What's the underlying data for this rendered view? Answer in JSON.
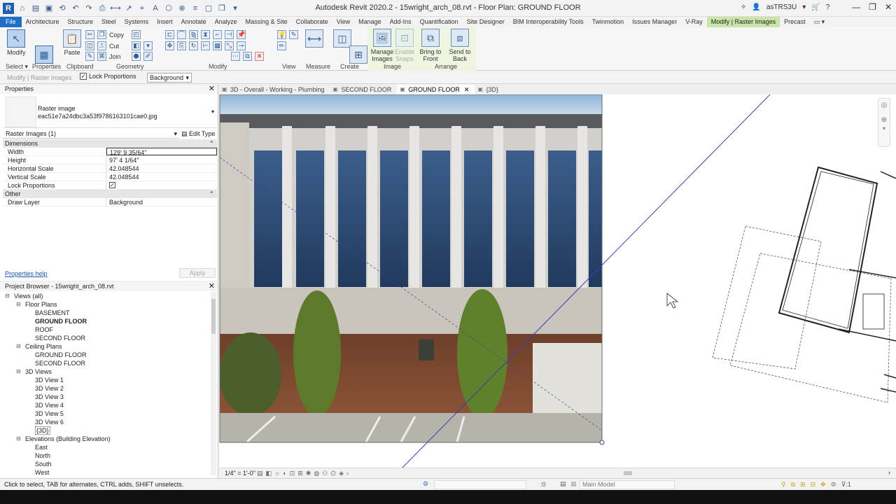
{
  "titlebar": {
    "title": "Autodesk Revit 2020.2 - 15wright_arch_08.rvt - Floor Plan: GROUND FLOOR",
    "user": "asTRS3U",
    "app_logo": "R"
  },
  "ribbon_tabs": [
    "File",
    "Architecture",
    "Structure",
    "Steel",
    "Systems",
    "Insert",
    "Annotate",
    "Analyze",
    "Massing & Site",
    "Collaborate",
    "View",
    "Manage",
    "Add-Ins",
    "Quantification",
    "Site Designer",
    "BIM Interoperability Tools",
    "Twinmotion",
    "Issues Manager",
    "V-Ray",
    "Modify | Raster Images",
    "Precast"
  ],
  "ribbon": {
    "modify": "Modify",
    "paste": "Paste",
    "properties": "Properties",
    "copy": "Copy",
    "cut": "Cut",
    "join": "Join",
    "manage_images": "Manage Images",
    "enable_snaps": "Enable Snaps",
    "bring_to_front": "Bring to Front",
    "send_to_back": "Send to Back",
    "panels": {
      "select": "Select",
      "properties": "Properties",
      "clipboard": "Clipboard",
      "geometry": "Geometry",
      "modify": "Modify",
      "view": "View",
      "measure": "Measure",
      "create": "Create",
      "image": "Image",
      "arrange": "Arrange"
    }
  },
  "optionsbar": {
    "context": "Modify | Raster Images",
    "lock_label": "Lock Proportions",
    "draw_layer": "Background"
  },
  "properties": {
    "title": "Properties",
    "type_line1": "Raster image",
    "type_line2": "eac51e7a24dbc3a53f9786163101cae0.jpg",
    "instance_selector": "Raster Images (1)",
    "edit_type": "Edit Type",
    "groups": {
      "dimensions": "Dimensions",
      "other": "Other"
    },
    "rows": {
      "width": {
        "k": "Width",
        "v": "129'  9 35/64\""
      },
      "height": {
        "k": "Height",
        "v": "97'  4 1/64\""
      },
      "hscale": {
        "k": "Horizontal Scale",
        "v": "42.048544"
      },
      "vscale": {
        "k": "Vertical Scale",
        "v": "42.048544"
      },
      "lock": {
        "k": "Lock Proportions",
        "v": "✓"
      },
      "draw_layer": {
        "k": "Draw Layer",
        "v": "Background"
      }
    },
    "help": "Properties help",
    "apply": "Apply"
  },
  "browser": {
    "title": "Project Browser - 15wright_arch_08.rvt",
    "views_all": "Views (all)",
    "floor_plans": "Floor Plans",
    "fp": [
      "BASEMENT",
      "GROUND FLOOR",
      "ROOF",
      "SECOND FLOOR"
    ],
    "ceiling_plans": "Ceiling Plans",
    "cp": [
      "GROUND FLOOR",
      "SECOND FLOOR"
    ],
    "views_3d": "3D Views",
    "v3d": [
      "3D View 1",
      "3D View 2",
      "3D View 3",
      "3D View 4",
      "3D View 5",
      "3D View 6",
      "{3D}"
    ],
    "elevations": "Elevations (Building Elevation)",
    "elev": [
      "East",
      "North",
      "South",
      "West"
    ]
  },
  "view_tabs": [
    "3D - Overall - Working - Plumbing",
    "SECOND FLOOR",
    "GROUND FLOOR",
    "{3D}"
  ],
  "viewbar": {
    "scale": "1/4\" = 1'-0\""
  },
  "statusbar": {
    "message": "Click to select, TAB for alternates, CTRL adds, SHIFT unselects.",
    "zero": ":0",
    "model": "Main Model"
  },
  "colors": {
    "file_tab": "#1f6fc6",
    "context_tab": "#c9e6a8",
    "crop_line": "#3c3cb4"
  }
}
